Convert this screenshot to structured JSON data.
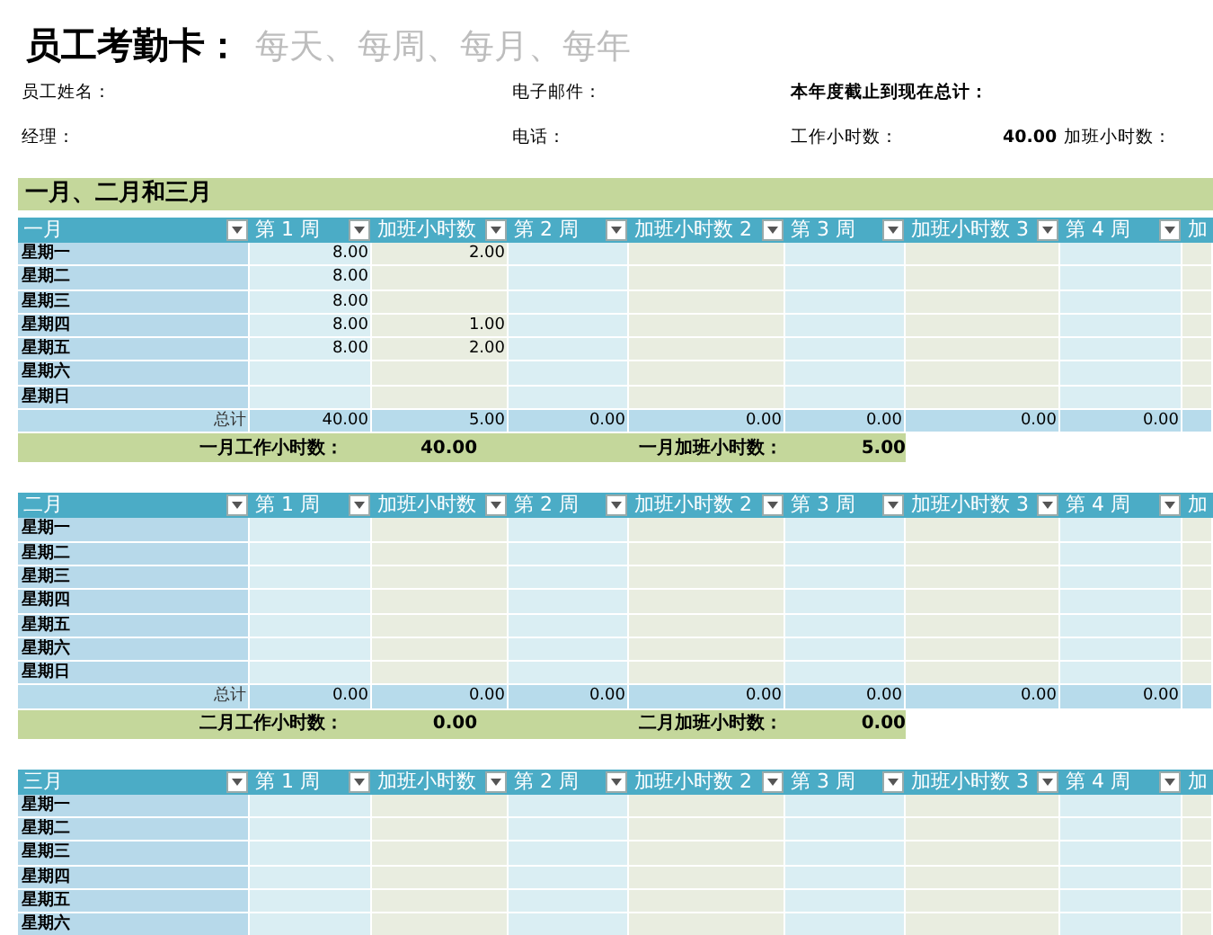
{
  "title": "员工考勤卡：",
  "subtitle": "每天、每周、每月、每年",
  "info": [
    {
      "label": "员工姓名：",
      "bold": false
    },
    {
      "label": "电子邮件：",
      "bold": false
    },
    {
      "label": "本年度截止到现在总计：",
      "bold": true
    },
    {
      "label": "经理：",
      "bold": false
    },
    {
      "label": "电话：",
      "bold": false
    },
    {
      "label": "工作小时数：",
      "bold": false
    },
    {
      "label": "40.00",
      "bold": true
    },
    {
      "label": "加班小时数：",
      "bold": false
    }
  ],
  "quarter_title": "一月、二月和三月",
  "months": [
    {
      "columns": [
        {
          "title": "一月",
          "kind": "label",
          "filter": true
        },
        {
          "title": "第 1 周",
          "kind": "week",
          "filter": true
        },
        {
          "title": "加班小时数",
          "kind": "overtime",
          "filter": true
        },
        {
          "title": "第 2 周",
          "kind": "week",
          "filter": true
        },
        {
          "title": "加班小时数 2",
          "kind": "overtime",
          "filter": true
        },
        {
          "title": "第 3 周",
          "kind": "week",
          "filter": true
        },
        {
          "title": "加班小时数 3",
          "kind": "overtime",
          "filter": true
        },
        {
          "title": "第 4 周",
          "kind": "week",
          "filter": true
        },
        {
          "title": "加",
          "kind": "overtime",
          "filter": false
        }
      ],
      "rows": [
        {
          "day": "星期一",
          "cells": [
            "8.00",
            "2.00",
            null,
            null,
            null,
            null,
            null,
            null
          ]
        },
        {
          "day": "星期二",
          "cells": [
            "8.00",
            null,
            null,
            null,
            null,
            null,
            null,
            null
          ]
        },
        {
          "day": "星期三",
          "cells": [
            "8.00",
            null,
            null,
            null,
            null,
            null,
            null,
            null
          ]
        },
        {
          "day": "星期四",
          "cells": [
            "8.00",
            "1.00",
            null,
            null,
            null,
            null,
            null,
            null
          ]
        },
        {
          "day": "星期五",
          "cells": [
            "8.00",
            "2.00",
            null,
            null,
            null,
            null,
            null,
            null
          ]
        },
        {
          "day": "星期六",
          "cells": [
            null,
            null,
            null,
            null,
            null,
            null,
            null,
            null
          ]
        },
        {
          "day": "星期日",
          "cells": [
            null,
            null,
            null,
            null,
            null,
            null,
            null,
            null
          ]
        }
      ],
      "total": {
        "label": "总计",
        "cells": [
          "40.00",
          "5.00",
          "0.00",
          "0.00",
          "0.00",
          "0.00",
          "0.00",
          null
        ]
      },
      "summary": [
        {
          "label": "一月工作小时数：",
          "value": "40.00"
        },
        {
          "label": "一月加班小时数：",
          "value": "5.00"
        }
      ]
    },
    {
      "columns": [
        {
          "title": "二月",
          "kind": "label",
          "filter": true
        },
        {
          "title": "第 1 周",
          "kind": "week",
          "filter": true
        },
        {
          "title": "加班小时数",
          "kind": "overtime",
          "filter": true
        },
        {
          "title": "第 2 周",
          "kind": "week",
          "filter": true
        },
        {
          "title": "加班小时数 2",
          "kind": "overtime",
          "filter": true
        },
        {
          "title": "第 3 周",
          "kind": "week",
          "filter": true
        },
        {
          "title": "加班小时数 3",
          "kind": "overtime",
          "filter": true
        },
        {
          "title": "第 4 周",
          "kind": "week",
          "filter": true
        },
        {
          "title": "加",
          "kind": "overtime",
          "filter": false
        }
      ],
      "rows": [
        {
          "day": "星期一",
          "cells": [
            null,
            null,
            null,
            null,
            null,
            null,
            null,
            null
          ]
        },
        {
          "day": "星期二",
          "cells": [
            null,
            null,
            null,
            null,
            null,
            null,
            null,
            null
          ]
        },
        {
          "day": "星期三",
          "cells": [
            null,
            null,
            null,
            null,
            null,
            null,
            null,
            null
          ]
        },
        {
          "day": "星期四",
          "cells": [
            null,
            null,
            null,
            null,
            null,
            null,
            null,
            null
          ]
        },
        {
          "day": "星期五",
          "cells": [
            null,
            null,
            null,
            null,
            null,
            null,
            null,
            null
          ]
        },
        {
          "day": "星期六",
          "cells": [
            null,
            null,
            null,
            null,
            null,
            null,
            null,
            null
          ]
        },
        {
          "day": "星期日",
          "cells": [
            null,
            null,
            null,
            null,
            null,
            null,
            null,
            null
          ]
        }
      ],
      "total": {
        "label": "总计",
        "cells": [
          "0.00",
          "0.00",
          "0.00",
          "0.00",
          "0.00",
          "0.00",
          "0.00",
          null
        ]
      },
      "summary": [
        {
          "label": "二月工作小时数：",
          "value": "0.00"
        },
        {
          "label": "二月加班小时数：",
          "value": "0.00"
        }
      ]
    },
    {
      "columns": [
        {
          "title": "三月",
          "kind": "label",
          "filter": true
        },
        {
          "title": "第 1 周",
          "kind": "week",
          "filter": true
        },
        {
          "title": "加班小时数",
          "kind": "overtime",
          "filter": true
        },
        {
          "title": "第 2 周",
          "kind": "week",
          "filter": true
        },
        {
          "title": "加班小时数 2",
          "kind": "overtime",
          "filter": true
        },
        {
          "title": "第 3 周",
          "kind": "week",
          "filter": true
        },
        {
          "title": "加班小时数 3",
          "kind": "overtime",
          "filter": true
        },
        {
          "title": "第 4 周",
          "kind": "week",
          "filter": true
        },
        {
          "title": "加",
          "kind": "overtime",
          "filter": false
        }
      ],
      "rows": [
        {
          "day": "星期一",
          "cells": [
            null,
            null,
            null,
            null,
            null,
            null,
            null,
            null
          ]
        },
        {
          "day": "星期二",
          "cells": [
            null,
            null,
            null,
            null,
            null,
            null,
            null,
            null
          ]
        },
        {
          "day": "星期三",
          "cells": [
            null,
            null,
            null,
            null,
            null,
            null,
            null,
            null
          ]
        },
        {
          "day": "星期四",
          "cells": [
            null,
            null,
            null,
            null,
            null,
            null,
            null,
            null
          ]
        },
        {
          "day": "星期五",
          "cells": [
            null,
            null,
            null,
            null,
            null,
            null,
            null,
            null
          ]
        },
        {
          "day": "星期六",
          "cells": [
            null,
            null,
            null,
            null,
            null,
            null,
            null,
            null
          ]
        }
      ]
    }
  ]
}
